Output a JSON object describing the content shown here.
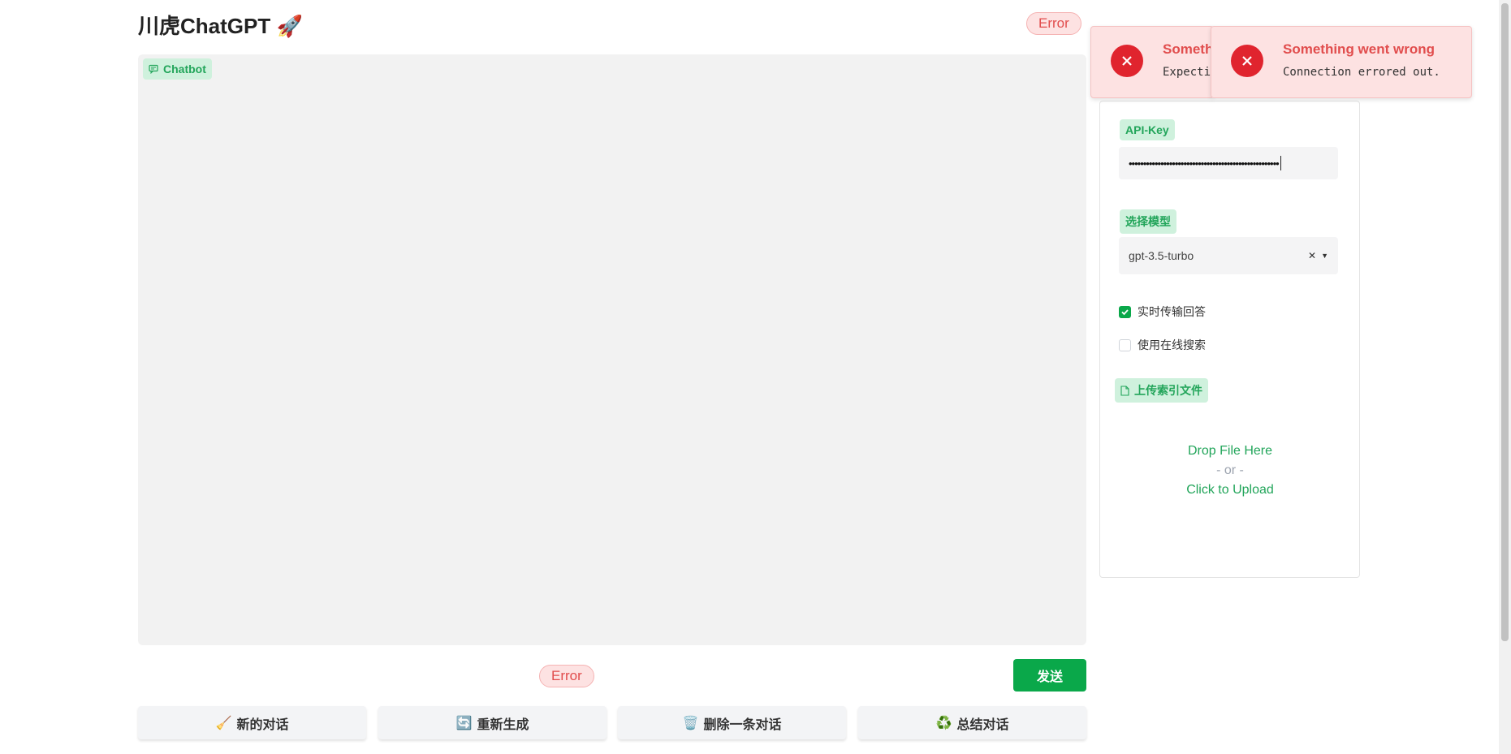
{
  "header": {
    "title": "川虎ChatGPT",
    "title_emoji": "🚀",
    "status": "Error"
  },
  "chatbot": {
    "label": "Chatbot"
  },
  "input": {
    "status": "Error",
    "send_label": "发送"
  },
  "actions": [
    {
      "icon": "🧹",
      "label": "新的对话"
    },
    {
      "icon": "🔄",
      "label": "重新生成"
    },
    {
      "icon": "🗑️",
      "label": "删除一条对话"
    },
    {
      "icon": "♻️",
      "label": "总结对话"
    }
  ],
  "settings": {
    "api_key_label": "API-Key",
    "api_key_value": "••••••••••••••••••••••••••••••••••••••••••••••••••••",
    "model_label": "选择模型",
    "model_value": "gpt-3.5-turbo",
    "stream_label": "实时传输回答",
    "stream_checked": true,
    "search_label": "使用在线搜索",
    "search_checked": false,
    "upload_label": "上传索引文件",
    "drop_text": "Drop File Here",
    "or_text": "- or -",
    "click_text": "Click to Upload"
  },
  "toasts": [
    {
      "title": "Someth",
      "message": "Expecti"
    },
    {
      "title": "Something went wrong",
      "message": "Connection errored out."
    }
  ],
  "colors": {
    "accent": "#0aa84a",
    "error": "#e14d4d",
    "tag_bg": "#cff1dd"
  }
}
